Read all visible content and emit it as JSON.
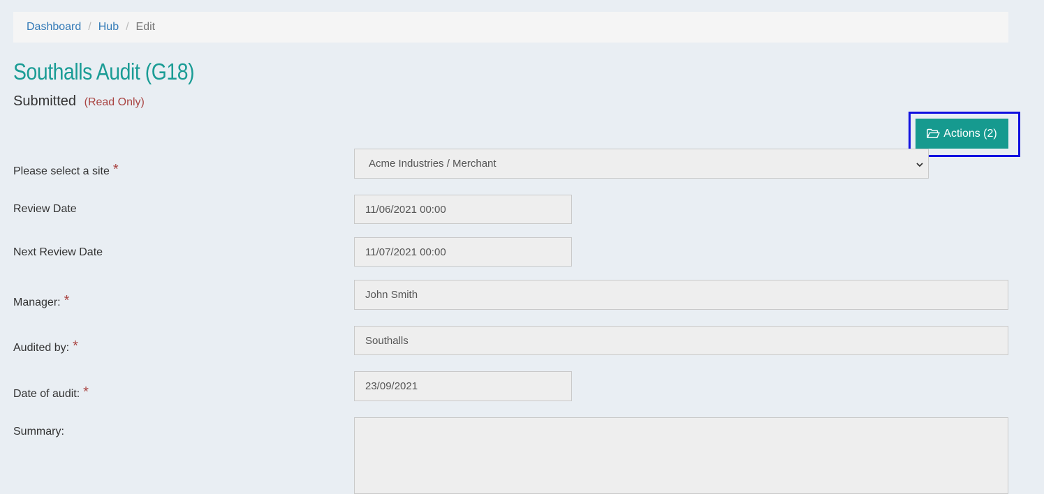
{
  "breadcrumb": {
    "items": [
      "Dashboard",
      "Hub"
    ],
    "active": "Edit",
    "separator": "/"
  },
  "page": {
    "title": "Southalls Audit (G18)",
    "status": "Submitted",
    "read_only": "(Read Only)"
  },
  "actions_button": {
    "icon": "folder-open-icon",
    "label": "Actions (2)"
  },
  "form": {
    "site": {
      "label": "Please select a site",
      "required": "*",
      "value": "Acme Industries / Merchant"
    },
    "review_date": {
      "label": "Review Date",
      "value": "11/06/2021 00:00"
    },
    "next_review_date": {
      "label": "Next Review Date",
      "value": "11/07/2021 00:00"
    },
    "manager": {
      "label": "Manager:",
      "required": "*",
      "value": "John Smith"
    },
    "audited_by": {
      "label": "Audited by:",
      "required": "*",
      "value": "Southalls"
    },
    "date_of_audit": {
      "label": "Date of audit:",
      "required": "*",
      "value": "23/09/2021"
    },
    "summary": {
      "label": "Summary:",
      "value": ""
    }
  },
  "colors": {
    "accent": "#1a9c95",
    "button": "#169a8f",
    "link": "#337ab7",
    "required": "#a94442",
    "highlight": "#1010e0"
  }
}
